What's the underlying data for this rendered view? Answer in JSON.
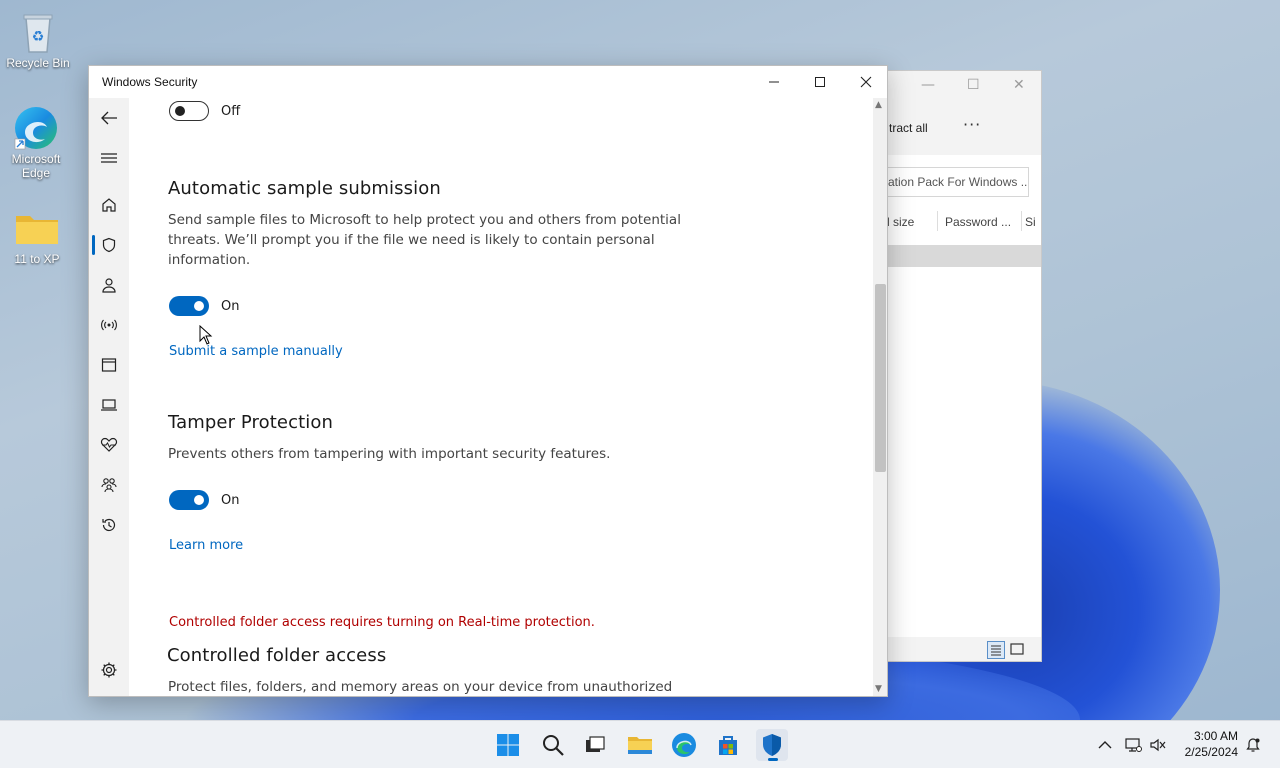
{
  "desktop": {
    "icons": [
      {
        "label": "Recycle Bin"
      },
      {
        "label": "Microsoft Edge"
      },
      {
        "label": "11 to XP"
      }
    ]
  },
  "background_window": {
    "toolbar_extract": "tract all",
    "toolbar_more": "···",
    "address": "ation Pack For Windows ...",
    "columns": [
      "l size",
      "Password ...",
      "Si"
    ]
  },
  "security_window": {
    "title": "Windows Security",
    "realtime_toggle": {
      "state": "Off"
    },
    "sample_submission": {
      "heading": "Automatic sample submission",
      "description": "Send sample files to Microsoft to help protect you and others from potential threats. We’ll prompt you if the file we need is likely to contain personal information.",
      "toggle_state": "On",
      "link": "Submit a sample manually"
    },
    "tamper_protection": {
      "heading": "Tamper Protection",
      "description": "Prevents others from tampering with important security features.",
      "toggle_state": "On",
      "link": "Learn more"
    },
    "controlled_folder": {
      "warning": "Controlled folder access requires turning on Real-time protection.",
      "heading": "Controlled folder access",
      "description": "Protect files, folders, and memory areas on your device from unauthorized"
    },
    "nav_items": [
      "back-icon",
      "menu-icon",
      "home-icon",
      "shield-icon",
      "person-icon",
      "wireless-icon",
      "app-browser-icon",
      "laptop-icon",
      "heart-icon",
      "family-icon",
      "history-icon",
      "gear-icon"
    ]
  },
  "taskbar": {
    "apps": [
      "start-icon",
      "search-icon",
      "task-view-icon",
      "file-explorer-icon",
      "edge-icon",
      "store-icon",
      "windows-security-icon"
    ],
    "time": "3:00 AM",
    "date": "2/25/2024"
  },
  "colors": {
    "accent": "#0067c0",
    "warning": "#b00000"
  }
}
